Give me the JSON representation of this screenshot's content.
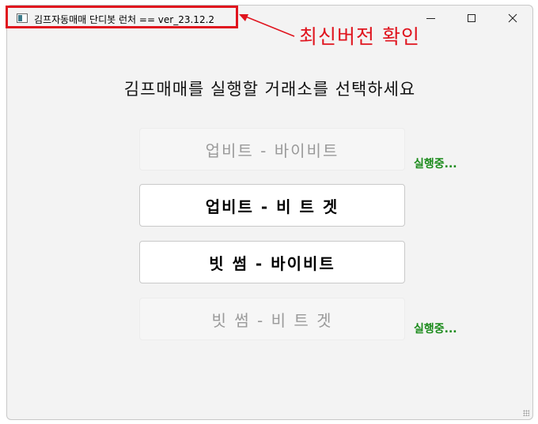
{
  "window": {
    "title": "김프자동매매 단디봇 런처 == ver_23.12.2",
    "controls": {
      "minimize": "minimize",
      "maximize": "maximize",
      "close": "✕"
    }
  },
  "main": {
    "heading": "김프매매를 실행할 거래소를 선택하세요",
    "exchanges": [
      {
        "label": "업비트 - 바이비트",
        "enabled": false,
        "status": "실행중..."
      },
      {
        "label": "업비트 - 비 트 겟",
        "enabled": true,
        "status": ""
      },
      {
        "label": "빗 썸 - 바이비트",
        "enabled": true,
        "status": ""
      },
      {
        "label": "빗 썸 - 비 트 겟",
        "enabled": false,
        "status": "실행중..."
      }
    ]
  },
  "annotation": {
    "text": "최신버전 확인",
    "color": "#e0141e"
  },
  "colors": {
    "status": "#1a8a1a",
    "disabled_text": "#9a9a9a",
    "window_bg": "#f3f3f3"
  }
}
